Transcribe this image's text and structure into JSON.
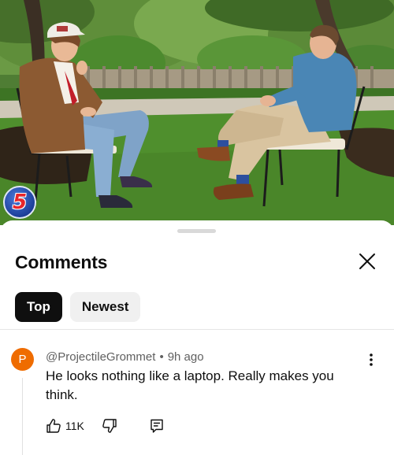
{
  "video": {
    "badge_text": "5"
  },
  "comments_sheet": {
    "title": "Comments",
    "tabs": [
      {
        "label": "Top",
        "selected": true
      },
      {
        "label": "Newest",
        "selected": false
      }
    ]
  },
  "comment": {
    "avatar_letter": "P",
    "avatar_color": "#ef6c00",
    "author": "@ProjectileGrommet",
    "separator": "•",
    "time": "9h ago",
    "text": "He looks nothing like a laptop. Really makes you think.",
    "like_count": "11K"
  },
  "icons": [
    "close-icon",
    "more-vertical-icon",
    "thumbs-up-icon",
    "thumbs-down-icon",
    "reply-icon"
  ]
}
